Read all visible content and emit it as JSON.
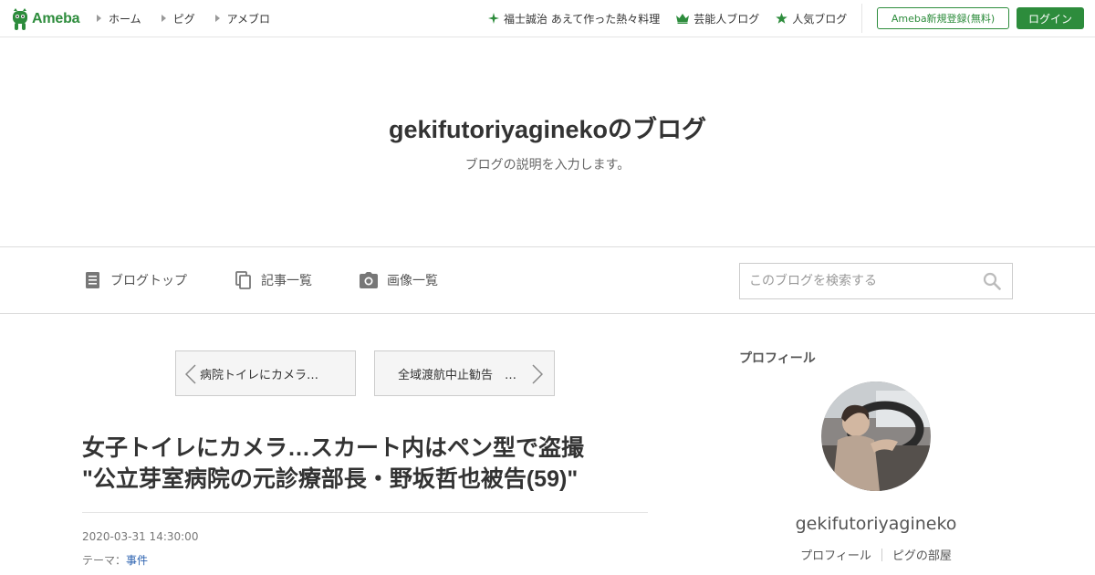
{
  "global_header": {
    "logo_text": "Ameba",
    "nav": [
      {
        "label": "ホーム"
      },
      {
        "label": "ピグ"
      },
      {
        "label": "アメブロ"
      }
    ],
    "featured": [
      {
        "label": "福士誠治 あえて作った熱々料理",
        "icon": "sparkle-icon"
      },
      {
        "label": "芸能人ブログ",
        "icon": "crown-icon"
      },
      {
        "label": "人気ブログ",
        "icon": "star-icon"
      }
    ],
    "register_label": "Ameba新規登録(無料)",
    "login_label": "ログイン",
    "brand_color": "#2d8c3c"
  },
  "blog": {
    "title": "gekifutoriyaginekoのブログ",
    "description": "ブログの説明を入力します。"
  },
  "blog_nav": {
    "items": [
      {
        "label": "ブログトップ",
        "icon": "document-icon"
      },
      {
        "label": "記事一覧",
        "icon": "copy-icon"
      },
      {
        "label": "画像一覧",
        "icon": "camera-icon"
      }
    ],
    "search_placeholder": "このブログを検索する"
  },
  "pager": {
    "prev_label": "病院トイレにカメラ…",
    "next_label": "全域渡航中止勧告　…"
  },
  "article": {
    "title_line1": "女子トイレにカメラ…スカート内はペン型で盗撮",
    "title_line2": "\"公立芽室病院の元診療部長・野坂哲也被告(59)\"",
    "date": "2020-03-31 14:30:00",
    "theme_label": "テーマ：",
    "theme_value": "事件"
  },
  "sidebar": {
    "heading": "プロフィール",
    "name": "gekifutoriyagineko",
    "links": [
      "プロフィール",
      "ピグの部屋"
    ]
  }
}
